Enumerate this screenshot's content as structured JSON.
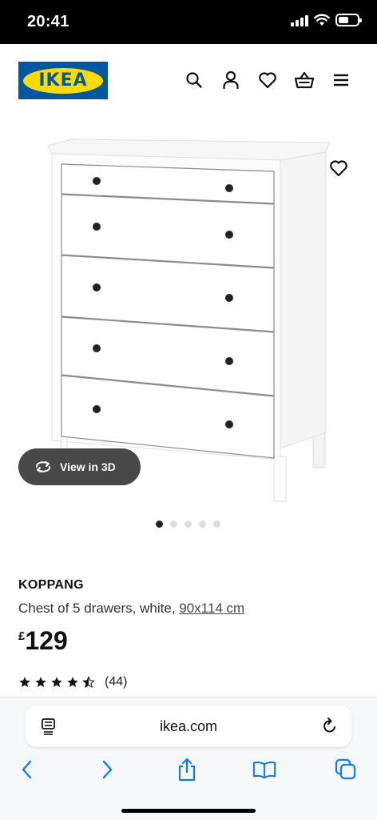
{
  "status_bar": {
    "time": "20:41"
  },
  "header": {
    "logo_text": "IKEA",
    "icons": [
      "search-icon",
      "account-icon",
      "heart-icon",
      "basket-icon",
      "menu-icon"
    ]
  },
  "gallery": {
    "view_3d_label": "View in 3D",
    "image_count": 5,
    "active_index": 0
  },
  "product": {
    "name": "KOPPANG",
    "description": "Chest of 5 drawers, white, ",
    "dimensions": "90x114 cm",
    "currency": "£",
    "price": "129",
    "rating": 4.5,
    "reviews_count": "(44)"
  },
  "browser": {
    "url": "ikea.com"
  },
  "colors": {
    "ikea_blue": "#0058a3",
    "ikea_yellow": "#ffdb00",
    "safari_blue": "#0a7aff",
    "pill_bg": "#484848"
  }
}
